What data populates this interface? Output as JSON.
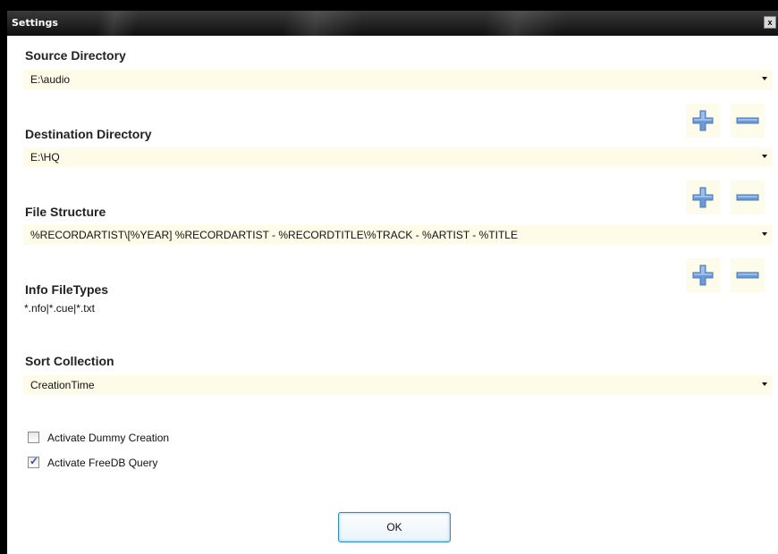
{
  "window": {
    "title": "Settings",
    "close_glyph": "x"
  },
  "source": {
    "label": "Source Directory",
    "value": "E:\\audio"
  },
  "destination": {
    "label": "Destination Directory",
    "value": "E:\\HQ"
  },
  "file_structure": {
    "label": "File Structure",
    "value": "%RECORDARTIST\\[%YEAR] %RECORDARTIST - %RECORDTITLE\\%TRACK - %ARTIST - %TITLE"
  },
  "info_filetypes": {
    "label": "Info FileTypes",
    "value": "*.nfo|*.cue|*.txt"
  },
  "sort": {
    "label": "Sort Collection",
    "value": "CreationTime"
  },
  "options": [
    {
      "label": "Activate Dummy Creation",
      "checked": false
    },
    {
      "label": "Activate FreeDB Query",
      "checked": true
    }
  ],
  "ok_label": "OK",
  "colors": {
    "field_bg": "#fefbe8",
    "icon_blue": "#6a9ad8",
    "titlebar": "#1a1a1a",
    "ok_border": "#2a8bd0"
  },
  "icons": {
    "add": "plus-icon",
    "remove": "minus-icon",
    "dropdown": "chevron-down-icon"
  }
}
